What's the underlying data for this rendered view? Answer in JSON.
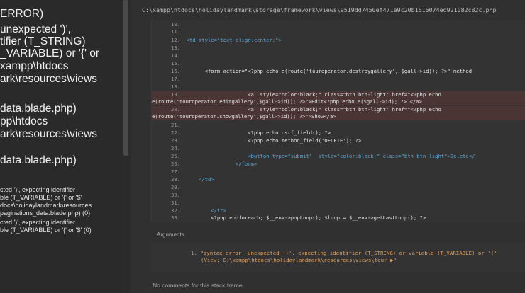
{
  "left_panel": {
    "big_lines": [
      "ERROR)",
      "unexpected ')',",
      "tifier (T_STRING)",
      "_VARIABLE) or '{' or",
      "xampp\\htdocs",
      "ark\\resources\\views",
      "data.blade.php)",
      "pp\\htdocs",
      "ark\\resources\\views",
      "data.blade.php)"
    ],
    "small_lines": [
      "cted ')', expecting identifier",
      "ble (T_VARIABLE) or '{' or '$'",
      "docs\\holidaylandmark\\resources",
      "paginations_data.blade.php) (0)",
      "cted ')', expecting identifier",
      "ble (T_VARIABLE) or '{' or '$' (0)"
    ]
  },
  "file_path": "C:\\xampp\\htdocs\\holidaylandmark\\storage\\framework\\views\\9519dd7450ef471e9c20b1616074ed921082c82c.php",
  "code_lines": [
    {
      "num": "10.",
      "text": ""
    },
    {
      "num": "11.",
      "text": ""
    },
    {
      "num": "12.",
      "text": "<td style=\"text-align:center;\">"
    },
    {
      "num": "13.",
      "text": ""
    },
    {
      "num": "14.",
      "text": ""
    },
    {
      "num": "15.",
      "text": ""
    },
    {
      "num": "16.",
      "text": "      <form action=\"<?php echo e(route('touroperator.destroygallery', $gall->id)); ?>\" method"
    },
    {
      "num": "17.",
      "text": ""
    },
    {
      "num": "18.",
      "text": ""
    },
    {
      "num": "19.",
      "text": "                    <a  style=\"color:black;\" class=\"btn btn-light\" href=\"<?php echo"
    },
    {
      "num": "",
      "text": "e(route('touroperator.editgallery',$gall->id)); ?>\">Edit<?php echo e($gall->id); ?> </a>"
    },
    {
      "num": "20.",
      "text": "                    <a  style=\"color:black;\" class=\"btn btn-light\" href=\"<?php echo"
    },
    {
      "num": "",
      "text": "e(route('touroperator.showgallery',$gall->id)); ?>\">Show</a>"
    },
    {
      "num": "21.",
      "text": ""
    },
    {
      "num": "22.",
      "text": "                    <?php echo csrf_field(); ?>"
    },
    {
      "num": "23.",
      "text": "                    <?php echo method_field('DELETE'); ?>"
    },
    {
      "num": "24.",
      "text": ""
    },
    {
      "num": "25.",
      "text": "                    <button type=\"submit\"  style=\"color:black;\" class=\"btn btn-light\">Delete</"
    },
    {
      "num": "26.",
      "text": "                </form>"
    },
    {
      "num": "27.",
      "text": ""
    },
    {
      "num": "28.",
      "text": "    </td>"
    },
    {
      "num": "29.",
      "text": ""
    },
    {
      "num": "30.",
      "text": ""
    },
    {
      "num": "31.",
      "text": ""
    },
    {
      "num": "32.",
      "text": "        </tr>"
    },
    {
      "num": "33.",
      "text": "        <?php endforeach; $__env->popLoop(); $loop = $__env->getLastLoop(); ?>"
    }
  ],
  "arguments_label": "Arguments",
  "argument": {
    "num": "1.",
    "line1": "\"syntax error, unexpected ')', expecting identifier (T_STRING) or variable (T_VARIABLE) or '{'",
    "line2": "(View: C:\\xampp\\htdocs\\holidaylandmark\\resources\\views\\tour ▶\""
  },
  "no_comments": "No comments for this stack frame."
}
